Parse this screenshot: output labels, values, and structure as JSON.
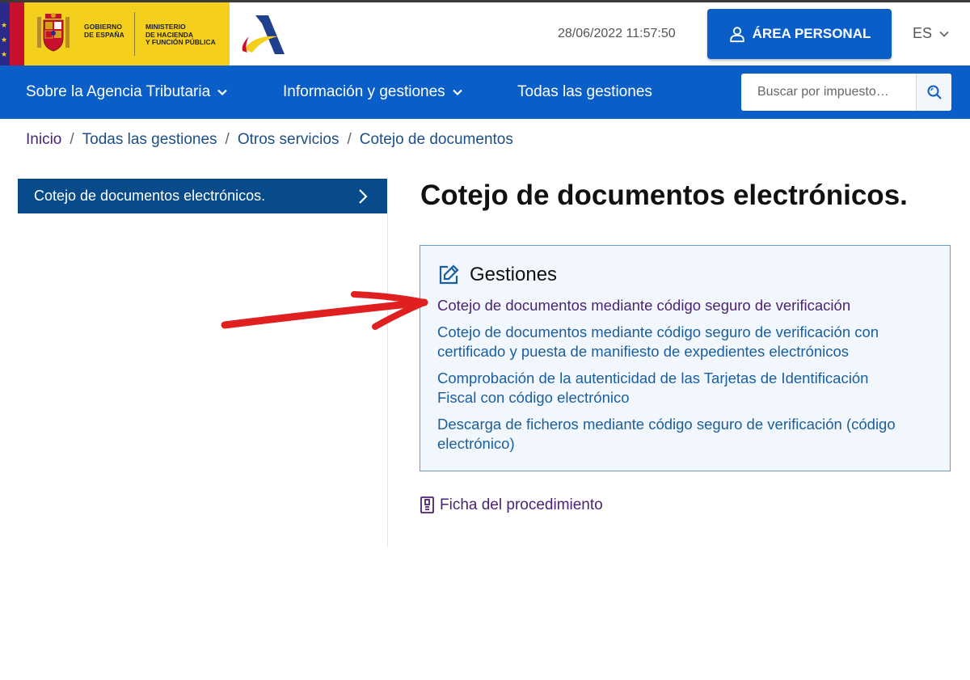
{
  "header": {
    "gov_text_lines": [
      "GOBIERNO",
      "DE ESPAÑA"
    ],
    "ministry_text_lines": [
      "MINISTERIO",
      "DE HACIENDA",
      "Y FUNCIÓN PÚBLICA"
    ],
    "datetime": "28/06/2022 11:57:50",
    "area_personal_label": "ÁREA PERSONAL",
    "language": "ES"
  },
  "nav": {
    "items": [
      {
        "label": "Sobre la Agencia Tributaria"
      },
      {
        "label": "Información y gestiones"
      },
      {
        "label": "Todas las gestiones"
      }
    ],
    "search_placeholder": "Buscar por impuesto…"
  },
  "breadcrumb": [
    "Inicio",
    "Todas las gestiones",
    "Otros servicios",
    "Cotejo de documentos"
  ],
  "breadcrumb_separator": "/",
  "sidebar": {
    "items": [
      {
        "label": "Cotejo de documentos electrónicos."
      }
    ]
  },
  "main": {
    "title": "Cotejo de documentos electrónicos.",
    "gestiones": {
      "heading": "Gestiones",
      "links": [
        {
          "lines": [
            "Cotejo de documentos mediante código seguro de verificación"
          ]
        },
        {
          "lines": [
            "Cotejo de documentos mediante código seguro de verificación con",
            "certificado y puesta de manifiesto de expedientes electrónicos"
          ]
        },
        {
          "lines": [
            "Comprobación de la autenticidad de las Tarjetas de Identificación",
            "Fiscal con código electrónico"
          ]
        },
        {
          "lines": [
            "Descarga de ficheros mediante código seguro de verificación (código",
            "electrónico)"
          ]
        }
      ]
    },
    "ficha_label": "Ficha del procedimiento"
  },
  "colors": {
    "primary_blue": "#0a5ec8",
    "sidebar_blue": "#084b8a",
    "link_blue": "#1b5e9e",
    "visited_purple": "#4b2375",
    "logo_yellow": "#f4cf1d",
    "annotation_red": "#e02020"
  },
  "icons": [
    "user-icon",
    "chevron-down-icon",
    "search-icon",
    "chevron-right-icon",
    "edit-icon",
    "document-icon",
    "red-arrow-annotation"
  ]
}
